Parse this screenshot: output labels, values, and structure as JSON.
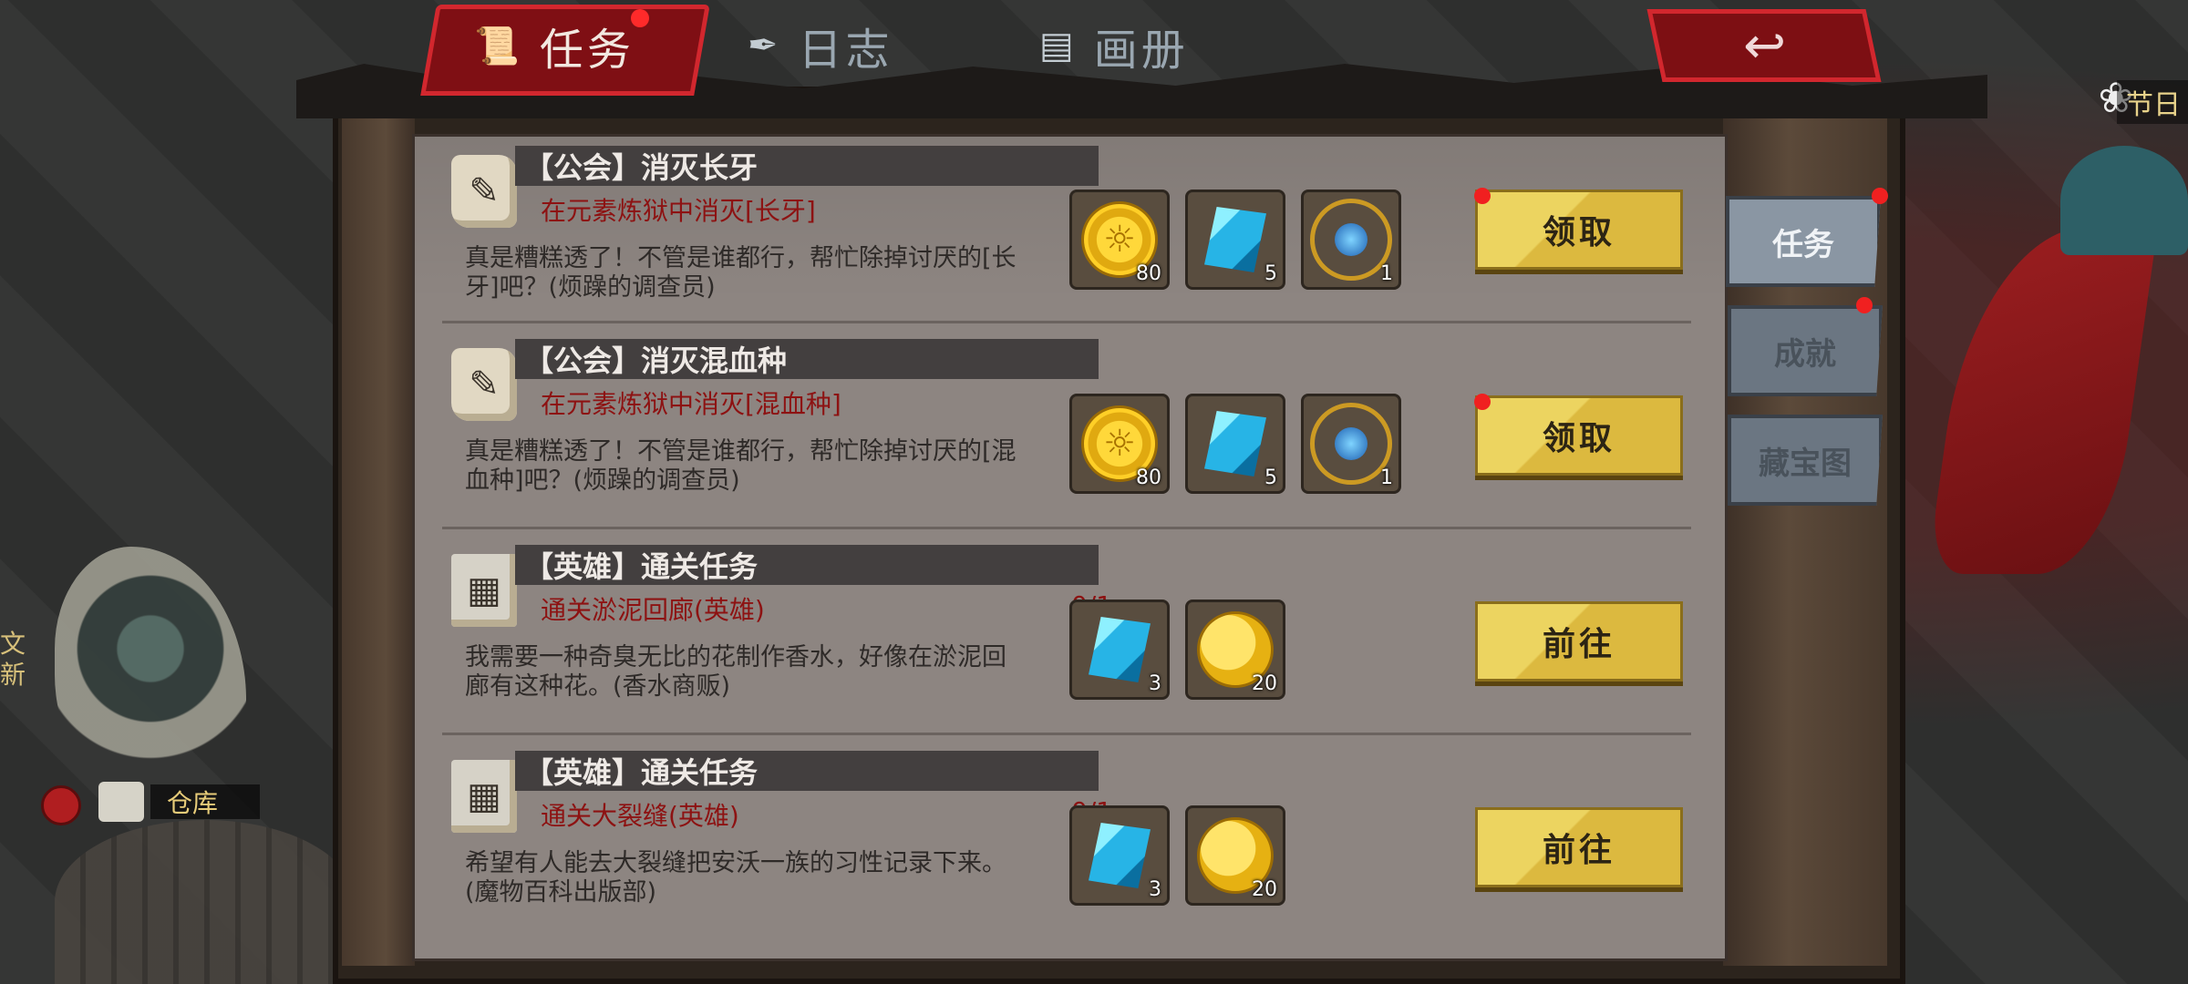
{
  "top_tabs": [
    {
      "label": "任务",
      "icon": "scroll-icon",
      "active": true
    },
    {
      "label": "日志",
      "icon": "quill-icon",
      "active": false
    },
    {
      "label": "画册",
      "icon": "book-icon",
      "active": false
    }
  ],
  "back_icon": "↩",
  "side_tabs": [
    {
      "label": "任务",
      "active": true
    },
    {
      "label": "成就",
      "active": false
    },
    {
      "label": "藏宝图",
      "active": false
    }
  ],
  "background": {
    "storage_label": "仓库",
    "festival_label": "节日",
    "left_edge_text": "文\n新"
  },
  "quests": [
    {
      "title": "【公会】消灭长牙",
      "objective": "在元素炼狱中消灭[长牙]",
      "progress": "",
      "description": "真是糟糕透了！不管是谁都行，帮忙除掉讨厌的[长牙]吧？(烦躁的调查员)",
      "rewards": [
        {
          "item": "sun-coin-icon",
          "count": "80"
        },
        {
          "item": "blue-crystal-icon",
          "count": "5"
        },
        {
          "item": "orb-icon",
          "count": "1"
        }
      ],
      "button": "领取"
    },
    {
      "title": "【公会】消灭混血种",
      "objective": "在元素炼狱中消灭[混血种]",
      "progress": "",
      "description": "真是糟糕透了！不管是谁都行，帮忙除掉讨厌的[混血种]吧？(烦躁的调查员)",
      "rewards": [
        {
          "item": "sun-coin-icon",
          "count": "80"
        },
        {
          "item": "blue-crystal-icon",
          "count": "5"
        },
        {
          "item": "orb-icon",
          "count": "1"
        }
      ],
      "button": "领取"
    },
    {
      "title": "【英雄】通关任务",
      "objective": "通关淤泥回廊(英雄)",
      "progress": "0/1",
      "description": "我需要一种奇臭无比的花制作香水，好像在淤泥回廊有这种花。(香水商贩)",
      "rewards": [
        {
          "item": "blue-crystal-icon",
          "count": "3"
        },
        {
          "item": "gold-coin-icon",
          "count": "20"
        }
      ],
      "button": "前往"
    },
    {
      "title": "【英雄】通关任务",
      "objective": "通关大裂缝(英雄)",
      "progress": "0/1",
      "description": "希望有人能去大裂缝把安沃一族的习性记录下来。(魔物百科出版部)",
      "rewards": [
        {
          "item": "blue-crystal-icon",
          "count": "3"
        },
        {
          "item": "gold-coin-icon",
          "count": "20"
        }
      ],
      "button": "前往"
    }
  ],
  "colors": {
    "board": "#8d8581",
    "title_bar": "#433f3f",
    "objective": "#8d1212",
    "button": "#ecd460",
    "active_tab": "#7f0f14",
    "badge": "#f02020"
  }
}
